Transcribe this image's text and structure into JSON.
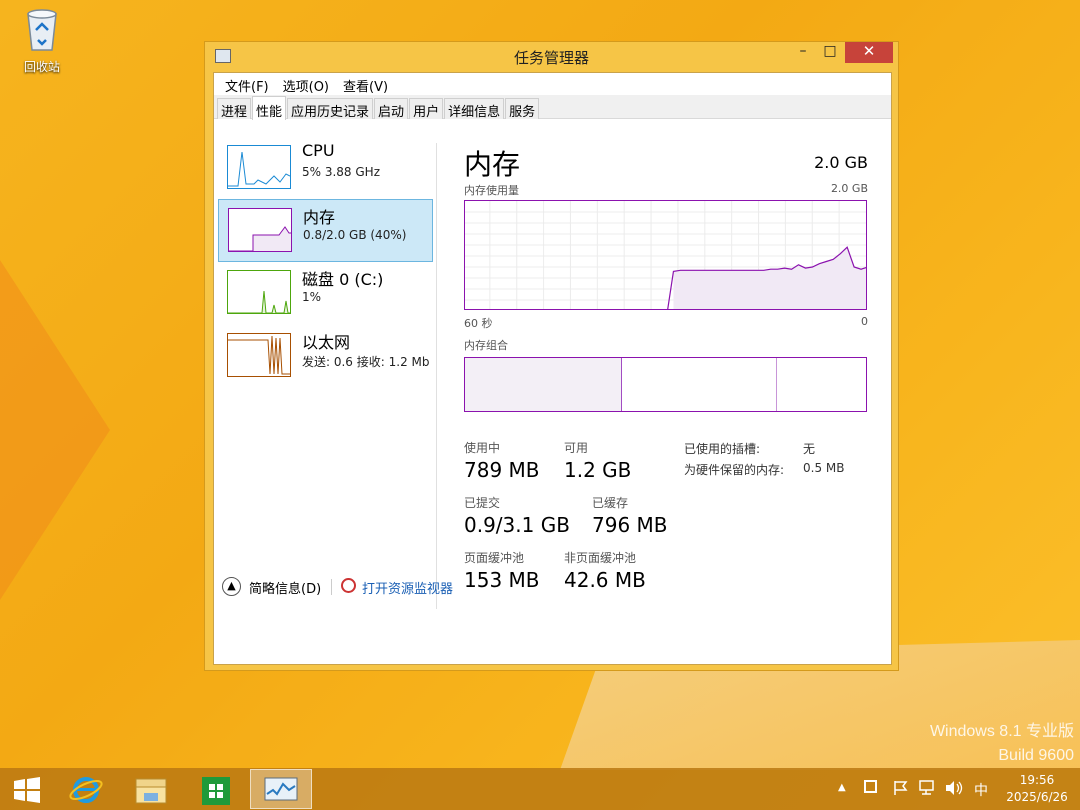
{
  "desktop": {
    "recycle_bin_label": "回收站",
    "watermark_line1": "Windows 8.1 专业版",
    "watermark_line2": "Build 9600"
  },
  "window": {
    "title": "任务管理器",
    "controls": {
      "minimize": "–",
      "maximize": "□",
      "close": "✕"
    },
    "menu": [
      "文件(F)",
      "选项(O)",
      "查看(V)"
    ],
    "tabs": [
      "进程",
      "性能",
      "应用历史记录",
      "启动",
      "用户",
      "详细信息",
      "服务"
    ],
    "active_tab": "性能"
  },
  "sidebar": {
    "items": [
      {
        "name": "CPU",
        "sub": "5% 3.88 GHz",
        "color": "#1a8ad4"
      },
      {
        "name": "内存",
        "sub": "0.8/2.0 GB (40%)",
        "color": "#8b12ae",
        "selected": true
      },
      {
        "name": "磁盘 0 (C:)",
        "sub": "1%",
        "color": "#4da60c"
      },
      {
        "name": "以太网",
        "sub": "发送: 0.6 接收: 1.2 Mb",
        "color": "#a74f01"
      }
    ]
  },
  "memory": {
    "title": "内存",
    "total": "2.0 GB",
    "usage_label": "内存使用量",
    "usage_max": "2.0 GB",
    "axis_left": "60 秒",
    "axis_right": "0",
    "composition_label": "内存组合",
    "usage_history_fraction": [
      0,
      0,
      0,
      0,
      0,
      0,
      0,
      0,
      0,
      0,
      0,
      0,
      0,
      0,
      0,
      0,
      0,
      0,
      0,
      0,
      0,
      0,
      0,
      0,
      0,
      0,
      0,
      0,
      0,
      0,
      0.36,
      0.37,
      0.37,
      0.37,
      0.37,
      0.37,
      0.37,
      0.37,
      0.37,
      0.37,
      0.37,
      0.37,
      0.37,
      0.37,
      0.38,
      0.38,
      0.39,
      0.38,
      0.42,
      0.39,
      0.4,
      0.43,
      0.45,
      0.47,
      0.52,
      0.58,
      0.4,
      0.38,
      0.4
    ],
    "stats": {
      "in_use_label": "使用中",
      "in_use": "789 MB",
      "available_label": "可用",
      "available": "1.2 GB",
      "committed_label": "已提交",
      "committed": "0.9/3.1 GB",
      "cached_label": "已缓存",
      "cached": "796 MB",
      "paged_label": "页面缓冲池",
      "paged": "153 MB",
      "nonpaged_label": "非页面缓冲池",
      "nonpaged": "42.6 MB",
      "slots_label": "已使用的插槽:",
      "slots": "无",
      "reserved_label": "为硬件保留的内存:",
      "reserved": "0.5 MB"
    }
  },
  "footer": {
    "brief_label": "简略信息(D)",
    "monitor_label": "打开资源监视器"
  },
  "taskbar": {
    "tray_ime": "中",
    "time": "19:56",
    "date": "2025/6/26"
  }
}
